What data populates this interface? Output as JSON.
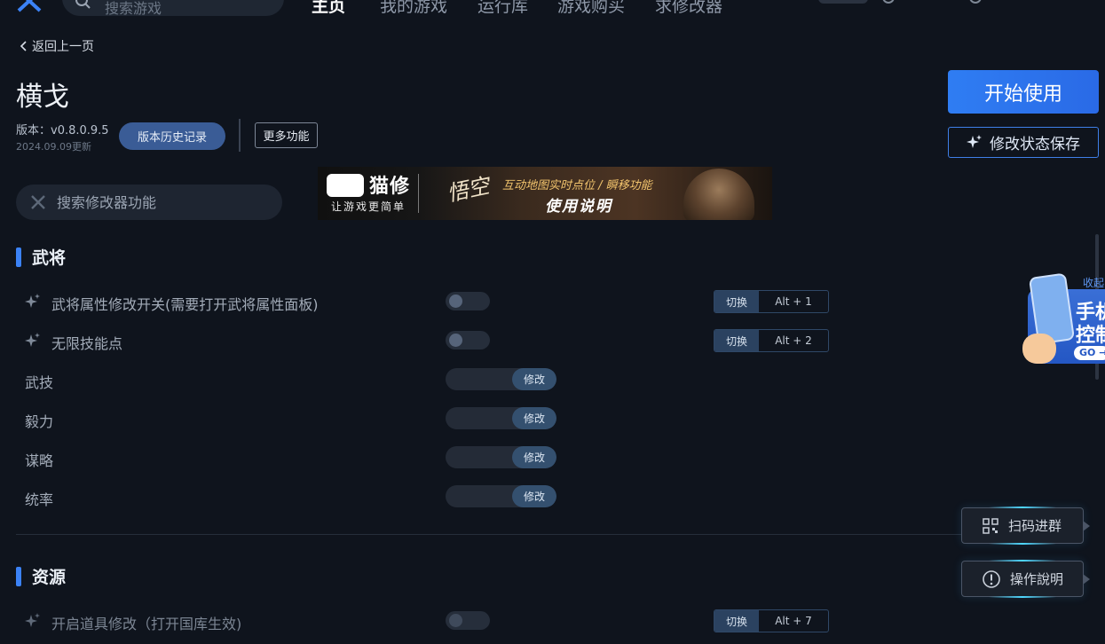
{
  "topnav": {
    "search_placeholder": "搜索游戏",
    "tabs": [
      {
        "label": "主页",
        "active": true
      },
      {
        "label": "我的游戏",
        "active": false
      },
      {
        "label": "运行库",
        "active": false
      },
      {
        "label": "游戏购买",
        "active": false
      },
      {
        "label": "求修改器",
        "active": false
      }
    ]
  },
  "header": {
    "back_label": "返回上一页",
    "title": "横戈",
    "version": "版本：v0.8.0.9.5",
    "updated": "2024.09.09更新",
    "history_button": "版本历史记录",
    "more_button": "更多功能",
    "start_button": "开始使用",
    "save_button": "修改状态保存"
  },
  "feature_search": {
    "placeholder": "搜索修改器功能"
  },
  "banner": {
    "brand": "猫修",
    "slogan": "让游戏更简单",
    "calligraphy": "悟空",
    "tagline": "互动地图实时点位 / 瞬移功能",
    "guide": "使用说明"
  },
  "sections": [
    {
      "title": "武将",
      "rows": [
        {
          "type": "toggle",
          "label": "武将属性修改开关(需要打开武将属性面板)",
          "on": false,
          "switch_label": "切换",
          "hotkey": "Alt + 1"
        },
        {
          "type": "toggle",
          "label": "无限技能点",
          "on": false,
          "switch_label": "切换",
          "hotkey": "Alt + 2"
        },
        {
          "type": "stepper",
          "label": "武技",
          "action": "修改"
        },
        {
          "type": "stepper",
          "label": "毅力",
          "action": "修改"
        },
        {
          "type": "stepper",
          "label": "谋略",
          "action": "修改"
        },
        {
          "type": "stepper",
          "label": "统率",
          "action": "修改"
        }
      ]
    },
    {
      "title": "资源",
      "rows": [
        {
          "type": "toggle",
          "label": "开启道具修改（打开国库生效)",
          "on": false,
          "switch_label": "切换",
          "hotkey": "Alt + 7"
        }
      ]
    }
  ],
  "side_ad": {
    "collect": "收起",
    "line1": "手机",
    "line2": "控制",
    "go": "GO →"
  },
  "float_buttons": {
    "scan": "扫码进群",
    "help": "操作說明"
  },
  "colors": {
    "accent": "#3b82f6",
    "background": "#0f141d",
    "primary_button": "#2f7df3"
  }
}
